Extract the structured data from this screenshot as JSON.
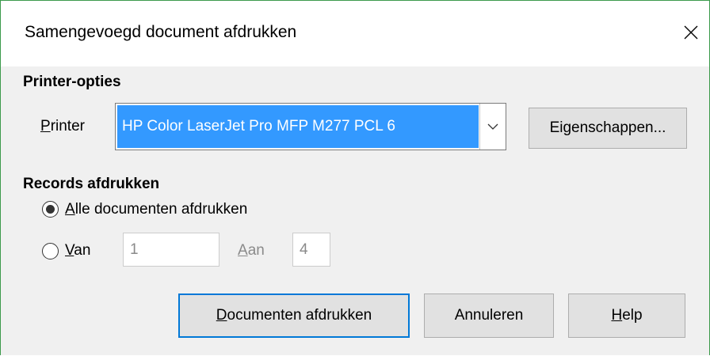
{
  "window": {
    "title": "Samengevoegd document afdrukken",
    "close_icon": "close-icon"
  },
  "printer_options": {
    "heading": "Printer-opties",
    "printer_label_accel": "P",
    "printer_label_rest": "rinter",
    "printer_selected": "HP Color LaserJet Pro MFP M277 PCL 6",
    "properties_accel": "g",
    "properties_pre": "Ei",
    "properties_rest": "enschappen..."
  },
  "records": {
    "heading": "Records afdrukken",
    "all_accel": "A",
    "all_rest": "lle documenten afdrukken",
    "all_selected": true,
    "from_accel": "V",
    "from_rest": "an",
    "from_value": "1",
    "to_accel": "A",
    "to_rest": "an",
    "to_value": "4"
  },
  "buttons": {
    "print_accel": "D",
    "print_rest": "ocumenten afdrukken",
    "cancel": "Annuleren",
    "help_accel": "H",
    "help_rest": "elp"
  },
  "colors": {
    "selection": "#3399ff",
    "default_button_border": "#0078d7",
    "window_border": "#3c9a4c"
  }
}
